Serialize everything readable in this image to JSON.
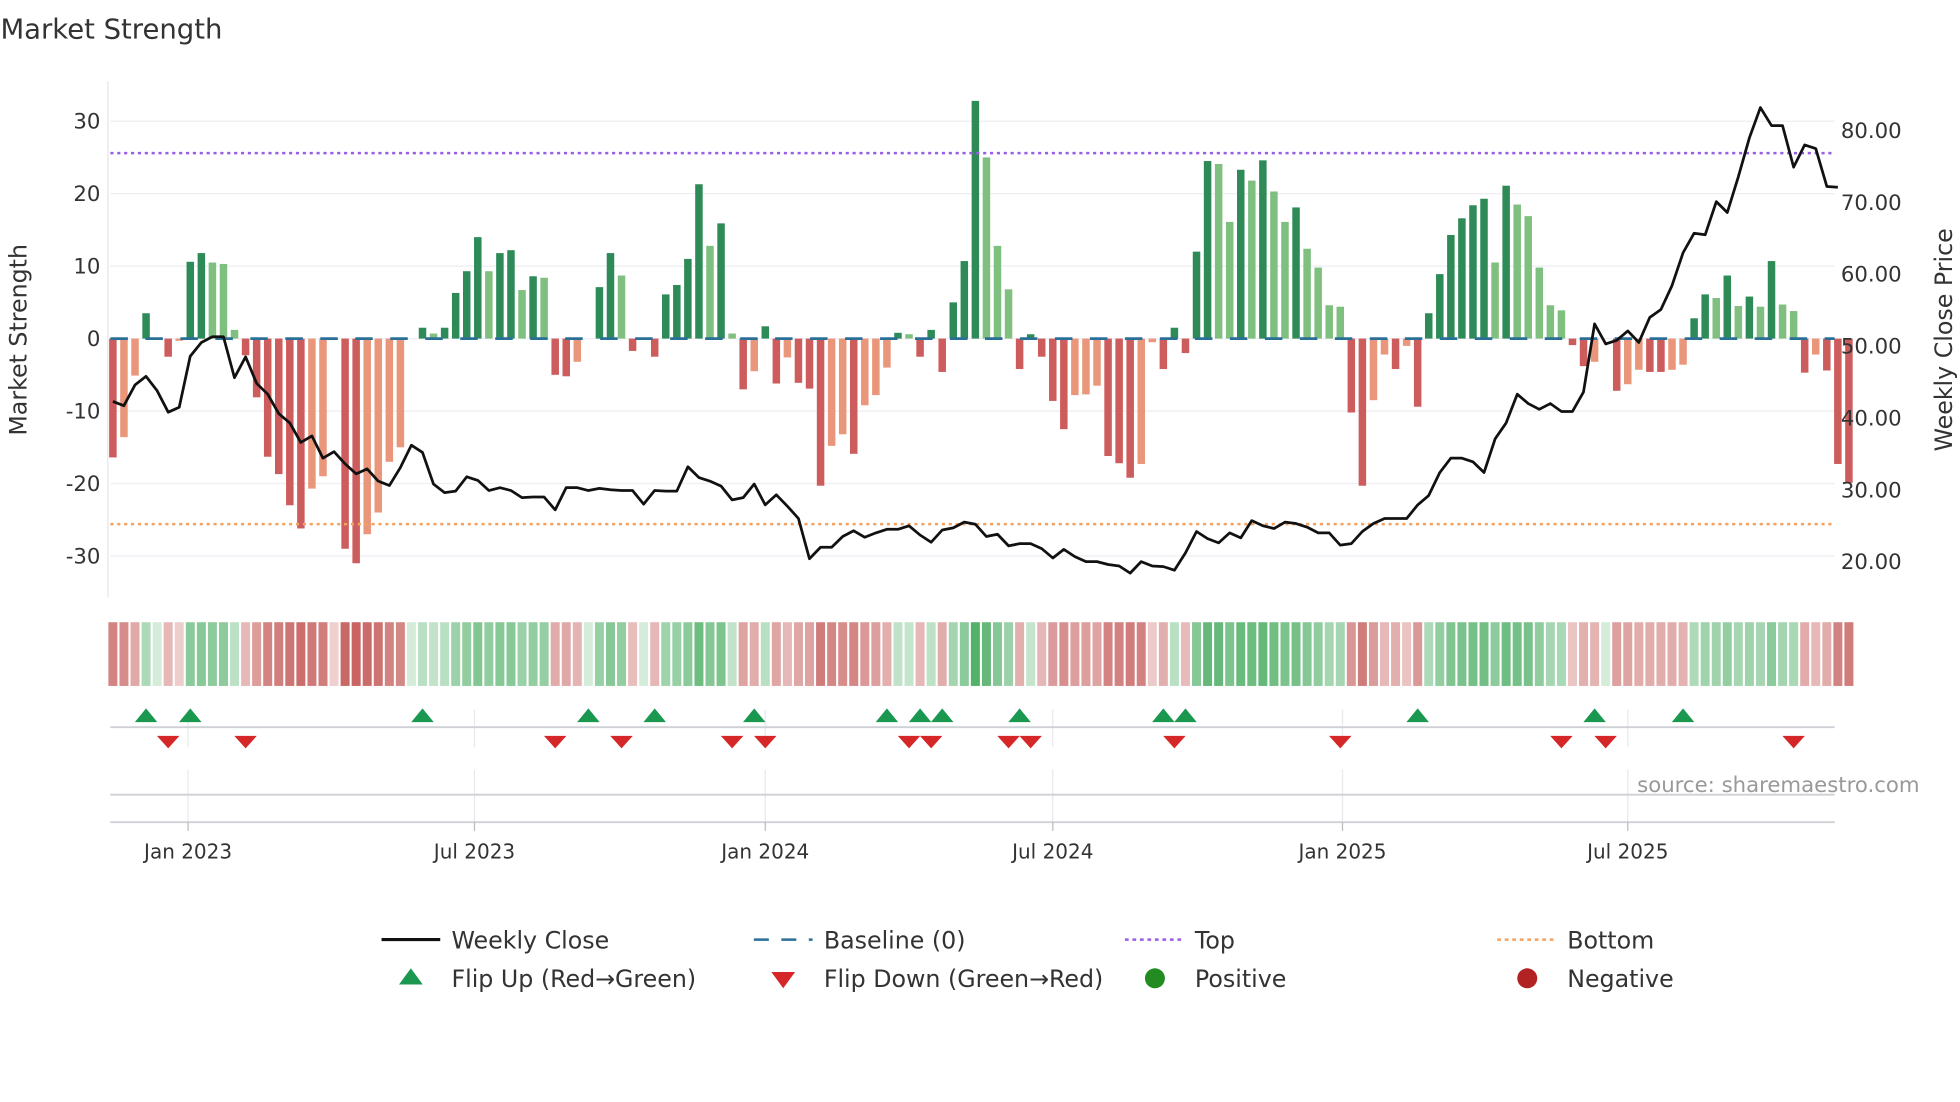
{
  "chart_data": {
    "type": "bar",
    "title": "Market Strength",
    "ylabel": "Market Strength",
    "y2label": "Weekly Close Price",
    "ylim": [
      -35,
      35
    ],
    "y2lim": [
      14.3,
      86.0
    ],
    "yticks": [
      30,
      20,
      10,
      0,
      -10,
      -20,
      -30
    ],
    "y2ticks": [
      "80.00",
      "70.00",
      "60.00",
      "50.00",
      "40.00",
      "30.00",
      "20.00"
    ],
    "top_level": 25.6,
    "bottom_level": -25.6,
    "xticks": [
      {
        "label": "Jan 2023",
        "week": 6.8
      },
      {
        "label": "Jul 2023",
        "week": 32.7
      },
      {
        "label": "Jan 2024",
        "week": 59.0
      },
      {
        "label": "Jul 2024",
        "week": 85.0
      },
      {
        "label": "Jan 2025",
        "week": 111.2
      },
      {
        "label": "Jul 2025",
        "week": 137.0
      }
    ],
    "strength": [
      -16.4,
      -13.6,
      -5.1,
      3.5,
      0,
      -2.5,
      -0.3,
      10.6,
      11.8,
      10.5,
      10.3,
      1.2,
      -2.3,
      -8.1,
      -16.3,
      -18.7,
      -23,
      -26.2,
      -20.7,
      -19,
      -0.2,
      -29,
      -31,
      -27,
      -24,
      -17,
      -15,
      0,
      1.5,
      0.7,
      1.5,
      6.3,
      9.3,
      14,
      9.3,
      11.8,
      12.2,
      6.7,
      8.6,
      8.4,
      -5,
      -5.2,
      -3.2,
      0,
      7.1,
      11.8,
      8.7,
      -1.7,
      0,
      -2.5,
      6.1,
      7.4,
      11,
      21.3,
      12.8,
      15.9,
      0.7,
      -7,
      -4.5,
      1.7,
      -6.2,
      -2.6,
      -6.1,
      -6.9,
      -20.3,
      -14.8,
      -13.2,
      -15.9,
      -9.2,
      -7.8,
      -4,
      0.8,
      0.6,
      -2.5,
      1.2,
      -4.6,
      5,
      10.7,
      32.8,
      25,
      12.8,
      6.8,
      -4.2,
      0.6,
      -2.5,
      -8.6,
      -12.5,
      -7.8,
      -7.7,
      -6.5,
      -16.2,
      -17.2,
      -19.2,
      -17.3,
      -0.5,
      -4.2,
      1.5,
      -2,
      12,
      24.5,
      24.1,
      16.1,
      23.3,
      21.8,
      24.6,
      20.3,
      16.1,
      18.1,
      12.4,
      9.8,
      4.6,
      4.4,
      -10.2,
      -20.3,
      -8.5,
      -2.2,
      -4.2,
      -1,
      -9.4,
      3.5,
      8.9,
      14.3,
      16.6,
      18.4,
      19.3,
      10.5,
      21.1,
      18.5,
      16.9,
      9.8,
      4.6,
      3.9,
      -0.9,
      -3.8,
      -3.2,
      0,
      -7.2,
      -6.3,
      -4.3,
      -4.6,
      -4.6,
      -4.3,
      -3.6,
      2.8,
      6.1,
      5.6,
      8.7,
      4.5,
      5.8,
      4.4,
      10.7,
      4.7,
      3.8,
      -4.7,
      -2.2,
      -4.4,
      -17.3,
      -19.9
    ],
    "weak": [
      0,
      1,
      1,
      0,
      0,
      0,
      1,
      0,
      0,
      1,
      1,
      1,
      0,
      0,
      0,
      0,
      0,
      0,
      1,
      1,
      0,
      0,
      0,
      1,
      1,
      1,
      1,
      0,
      0,
      1,
      0,
      0,
      0,
      0,
      1,
      0,
      0,
      1,
      0,
      1,
      0,
      0,
      1,
      0,
      0,
      0,
      1,
      0,
      0,
      0,
      0,
      0,
      0,
      0,
      1,
      0,
      1,
      0,
      1,
      0,
      0,
      1,
      0,
      0,
      0,
      1,
      1,
      0,
      1,
      1,
      1,
      0,
      1,
      0,
      0,
      0,
      0,
      0,
      0,
      1,
      1,
      1,
      0,
      0,
      0,
      0,
      0,
      1,
      1,
      1,
      0,
      0,
      0,
      1,
      1,
      0,
      0,
      0,
      0,
      0,
      1,
      1,
      0,
      1,
      0,
      1,
      1,
      0,
      1,
      1,
      1,
      1,
      0,
      0,
      1,
      1,
      0,
      1,
      0,
      0,
      0,
      0,
      0,
      0,
      0,
      1,
      0,
      1,
      1,
      1,
      1,
      1,
      0,
      0,
      1,
      0,
      0,
      1,
      1,
      0,
      0,
      1,
      1,
      0,
      0,
      1,
      0,
      1,
      0,
      1,
      0,
      1,
      1,
      0,
      1,
      0,
      0,
      0
    ],
    "weekly_close": [
      42.3,
      41.7,
      44.6,
      45.8,
      43.8,
      40.8,
      41.5,
      48.6,
      50.5,
      51.3,
      51.3,
      45.6,
      48.5,
      44.8,
      43.3,
      40.6,
      39.3,
      36.6,
      37.5,
      34.4,
      35.3,
      33.6,
      32.2,
      32.9,
      31.2,
      30.6,
      33.1,
      36.2,
      35.2,
      30.8,
      29.6,
      29.8,
      31.8,
      31.3,
      29.9,
      30.3,
      29.9,
      28.9,
      29.0,
      29.0,
      27.2,
      30.3,
      30.3,
      29.9,
      30.2,
      30.0,
      29.9,
      29.9,
      28.0,
      29.9,
      29.8,
      29.8,
      33.2,
      31.7,
      31.2,
      30.5,
      28.6,
      28.9,
      30.8,
      27.9,
      29.3,
      27.7,
      26.0,
      20.4,
      22.0,
      22.0,
      23.5,
      24.3,
      23.4,
      24.0,
      24.5,
      24.5,
      25.0,
      23.7,
      22.7,
      24.4,
      24.7,
      25.5,
      25.2,
      23.5,
      23.8,
      22.2,
      22.5,
      22.5,
      21.8,
      20.5,
      21.7,
      20.7,
      20.0,
      20.0,
      19.6,
      19.4,
      18.4,
      20.0,
      19.4,
      19.3,
      18.8,
      21.2,
      24.2,
      23.2,
      22.6,
      24.0,
      23.3,
      25.7,
      25.0,
      24.6,
      25.5,
      25.3,
      24.8,
      24.0,
      24.0,
      22.3,
      22.5,
      24.2,
      25.3,
      26.0,
      26.0,
      26.0,
      27.9,
      29.2,
      32.4,
      34.4,
      34.4,
      33.9,
      32.4,
      37.1,
      39.3,
      43.3,
      42.0,
      41.2,
      42.0,
      40.9,
      40.9,
      43.6,
      53.1,
      50.3,
      50.8,
      52.1,
      50.5,
      54.0,
      55.1,
      58.4,
      63.0,
      65.7,
      65.5,
      70.1,
      68.6,
      73.6,
      79.0,
      83.2,
      80.7,
      80.7,
      74.9,
      78.0,
      77.5,
      72.2,
      72.1
    ],
    "flip_up_weeks": [
      3,
      7,
      28,
      43,
      49,
      58,
      70,
      73,
      75,
      82,
      95,
      97,
      118,
      134,
      142
    ],
    "flip_down_weeks": [
      5,
      12,
      40,
      46,
      56,
      59,
      72,
      74,
      81,
      83,
      96,
      111,
      131,
      135,
      152
    ],
    "legend": {
      "placement": "bottom",
      "entries": [
        {
          "label": "Weekly Close",
          "kind": "line"
        },
        {
          "label": "Baseline (0)",
          "kind": "dash"
        },
        {
          "label": "Top",
          "kind": "dot-purple"
        },
        {
          "label": "Bottom",
          "kind": "dot-orange"
        },
        {
          "label": "Flip Up (Red→Green)",
          "kind": "tri-up"
        },
        {
          "label": "Flip Down (Green→Red)",
          "kind": "tri-down"
        },
        {
          "label": "Positive",
          "kind": "circle-green"
        },
        {
          "label": "Negative",
          "kind": "circle-red"
        }
      ]
    },
    "source": "source: sharemaestro.com"
  },
  "colors": {
    "strong_pos": "#2e8b57",
    "weak_pos": "#7fbf7f",
    "strong_neg": "#cd5c5c",
    "weak_neg": "#e9967a",
    "top": "#9b5de5",
    "bottom": "#f4a261",
    "baseline": "#2a6f97",
    "flip_up": "#1a9850",
    "flip_down": "#d62728",
    "positive": "#228b22",
    "negative": "#b22222"
  }
}
